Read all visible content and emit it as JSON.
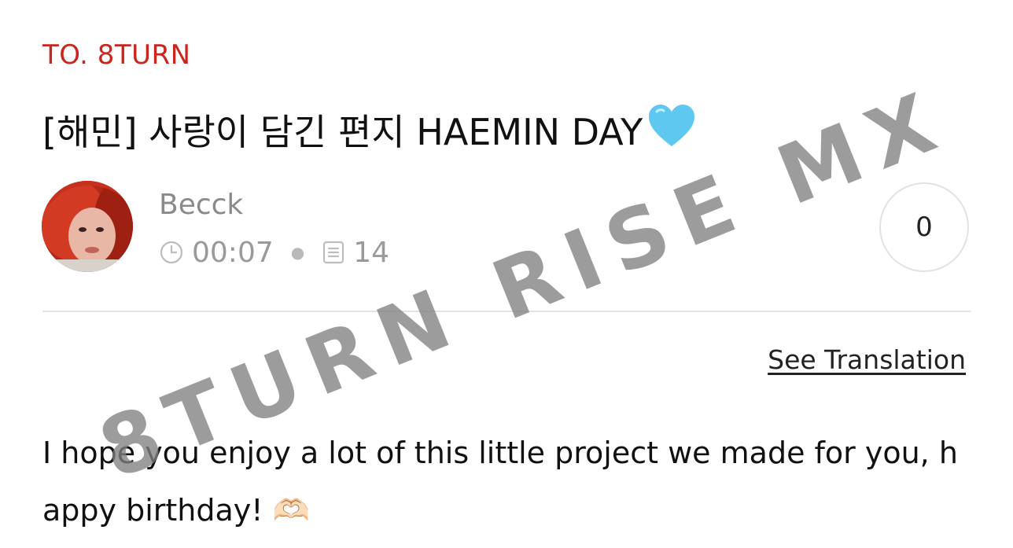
{
  "post": {
    "board": "TO. 8TURN",
    "title": "[해민] 사랑이 담긴 편지 HAEMIN DAY",
    "title_emoji": "light-blue-heart",
    "author": "Becck",
    "time": "00:07",
    "views": "14",
    "likes": "0",
    "translate_label": "See Translation",
    "body": "I hope you enjoy a lot of this little project we made for you, happy birthday! 🫶🏻"
  },
  "watermark": "8TURN RISE MX",
  "colors": {
    "board": "#c8261f",
    "text": "#111111",
    "meta": "#9a9a9a",
    "divider": "#e4e4e4",
    "heart": "#5ec8f0",
    "watermark": "#808080"
  },
  "icons": [
    "clock-icon",
    "document-icon",
    "heart-emoji-icon"
  ]
}
